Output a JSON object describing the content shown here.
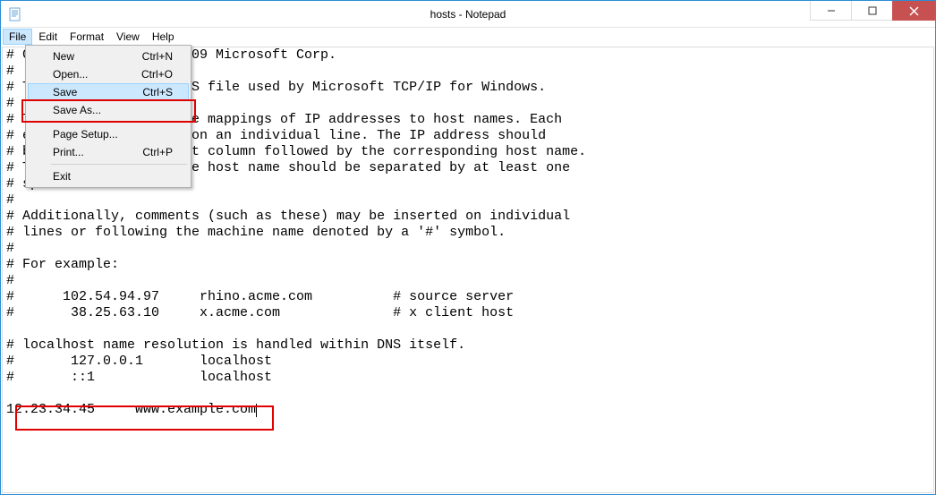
{
  "window": {
    "title": "hosts - Notepad"
  },
  "menubar": {
    "items": [
      {
        "label": "File",
        "active": true
      },
      {
        "label": "Edit",
        "active": false
      },
      {
        "label": "Format",
        "active": false
      },
      {
        "label": "View",
        "active": false
      },
      {
        "label": "Help",
        "active": false
      }
    ]
  },
  "file_menu": {
    "items": [
      {
        "label": "New",
        "shortcut": "Ctrl+N",
        "hover": false
      },
      {
        "label": "Open...",
        "shortcut": "Ctrl+O",
        "hover": false
      },
      {
        "label": "Save",
        "shortcut": "Ctrl+S",
        "hover": true
      },
      {
        "label": "Save As...",
        "shortcut": "",
        "hover": false
      },
      {
        "sep": true
      },
      {
        "label": "Page Setup...",
        "shortcut": "",
        "hover": false
      },
      {
        "label": "Print...",
        "shortcut": "Ctrl+P",
        "hover": false
      },
      {
        "sep": true
      },
      {
        "label": "Exit",
        "shortcut": "",
        "hover": false
      }
    ]
  },
  "editor": {
    "content": "# Copyright (c) 1993-2009 Microsoft Corp.\n#\n# This is a sample HOSTS file used by Microsoft TCP/IP for Windows.\n#\n# This file contains the mappings of IP addresses to host names. Each\n# entry should be kept on an individual line. The IP address should\n# be placed in the first column followed by the corresponding host name.\n# The IP address and the host name should be separated by at least one\n# space.\n#\n# Additionally, comments (such as these) may be inserted on individual\n# lines or following the machine name denoted by a '#' symbol.\n#\n# For example:\n#\n#      102.54.94.97     rhino.acme.com          # source server\n#       38.25.63.10     x.acme.com              # x client host\n\n# localhost name resolution is handled within DNS itself.\n#       127.0.0.1       localhost\n#       ::1             localhost\n\n12.23.34.45     www.example.com"
  },
  "window_controls": {
    "minimize": "–",
    "maximize": "□",
    "close": "✕"
  }
}
